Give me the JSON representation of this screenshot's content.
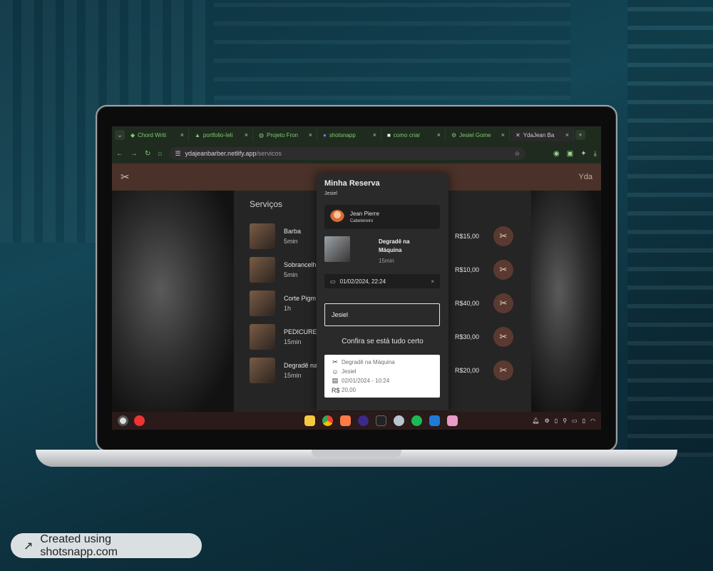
{
  "browser": {
    "tabs": [
      {
        "label": "Chord Writi",
        "icon": "gem-icon"
      },
      {
        "label": "portfolio-Ieli",
        "icon": "triangle-icon"
      },
      {
        "label": "Projeto Fron",
        "icon": "globe-icon"
      },
      {
        "label": "shotsnapp",
        "icon": "s-logo-icon"
      },
      {
        "label": "como criar",
        "icon": "p-logo-icon"
      },
      {
        "label": "Jesiel Gome",
        "icon": "gear-icon"
      },
      {
        "label": "YdaJean Ba",
        "icon": "x-logo-icon"
      }
    ],
    "url_host": "ydajeanbarber.netlify.app",
    "url_path": "/servicos"
  },
  "site": {
    "brand": "Yda",
    "services_title": "Serviços",
    "services": [
      {
        "name": "Barba",
        "duration": "5min",
        "price": "R$15,00"
      },
      {
        "name": "Sobrancelh",
        "duration": "5min",
        "price": "R$10,00"
      },
      {
        "name": "Corte Pigm",
        "duration": "1h",
        "price": "R$40,00"
      },
      {
        "name": "PEDICURE",
        "duration": "15min",
        "price": "R$30,00"
      },
      {
        "name": "Degradê na",
        "duration": "15min",
        "price": "R$20,00"
      }
    ]
  },
  "reservation": {
    "title": "Minha Reserva",
    "user": "Jesiel",
    "barber_name": "Jean Pierre",
    "barber_role": "Cabeleireiro",
    "service_name": "Degradê na Máquina",
    "service_duration": "15min",
    "datetime": "01/02/2024, 22:24",
    "name_value": "Jesiel",
    "confirm_text": "Confira se está tudo certo",
    "summary": {
      "service": "Degradê na Máquina",
      "client": "Jesiel",
      "date": "02/01/2024 - 10:24",
      "price": "20,00"
    }
  },
  "badge": {
    "text": "Created using shotsnapp.com"
  },
  "colors": {
    "nav": "#4a3129",
    "book_button": "#5a3a30",
    "tab_text": "#7ecb6f"
  }
}
